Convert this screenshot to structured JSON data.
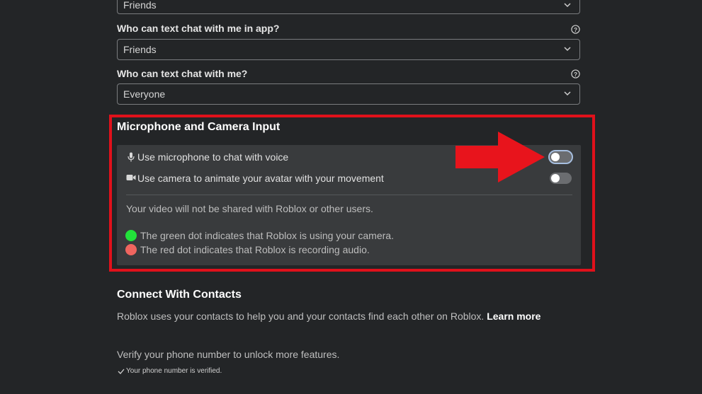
{
  "privacy": {
    "top_select": {
      "value": "Friends"
    },
    "in_app_chat": {
      "label": "Who can text chat with me in app?",
      "value": "Friends"
    },
    "chat": {
      "label": "Who can text chat with me?",
      "value": "Everyone"
    }
  },
  "mic_camera": {
    "title": "Microphone and Camera Input",
    "mic_label": "Use microphone to chat with voice",
    "mic_enabled": false,
    "camera_label": "Use camera to animate your avatar with your movement",
    "camera_enabled": false,
    "video_note": "Your video will not be shared with Roblox or other users.",
    "green_note": "The green dot indicates that Roblox is using your camera.",
    "red_note": "The red dot indicates that Roblox is recording audio.",
    "green_color": "#22e23a",
    "red_color": "#f0655f"
  },
  "contacts": {
    "title": "Connect With Contacts",
    "description": "Roblox uses your contacts to help you and your contacts find each other on Roblox.",
    "learn_more": "Learn more",
    "verify_text": "Verify your phone number to unlock more features.",
    "verified_text": "Your phone number is verified."
  },
  "annotation": {
    "highlight_color": "#e0111b",
    "arrow_color": "#e8141c"
  }
}
